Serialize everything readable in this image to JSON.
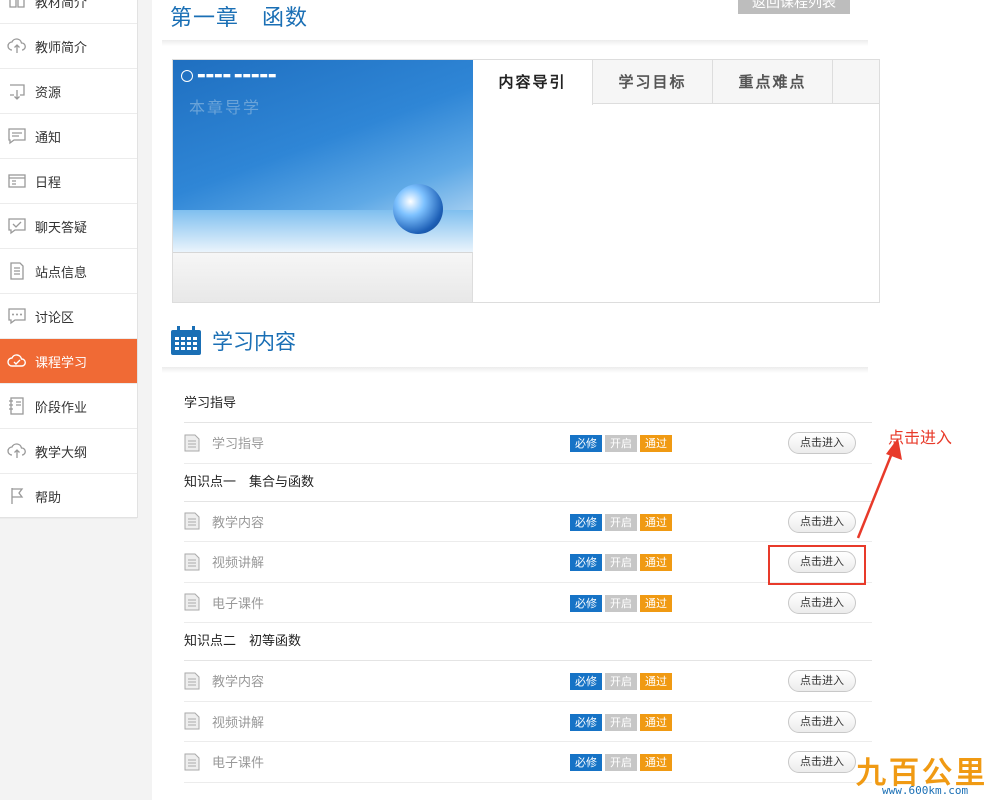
{
  "sidebar": {
    "items": [
      {
        "label": "教材简介",
        "icon": "book-icon"
      },
      {
        "label": "教师简介",
        "icon": "cloud-upload-icon"
      },
      {
        "label": "资源",
        "icon": "download-box-icon"
      },
      {
        "label": "通知",
        "icon": "message-icon"
      },
      {
        "label": "日程",
        "icon": "calendar-card-icon"
      },
      {
        "label": "聊天答疑",
        "icon": "chat-check-icon"
      },
      {
        "label": "站点信息",
        "icon": "document-icon"
      },
      {
        "label": "讨论区",
        "icon": "speech-dots-icon"
      },
      {
        "label": "课程学习",
        "icon": "cloud-check-icon",
        "active": true
      },
      {
        "label": "阶段作业",
        "icon": "notebook-icon"
      },
      {
        "label": "教学大纲",
        "icon": "cloud-upload-icon"
      },
      {
        "label": "帮助",
        "icon": "flag-icon"
      }
    ]
  },
  "header": {
    "chapter_title": "第一章　函数",
    "back_label": "返回课程列表"
  },
  "intro": {
    "banner_title": "本章导学",
    "tabs": [
      "内容导引",
      "学习目标",
      "重点难点"
    ]
  },
  "section": {
    "title": "学习内容"
  },
  "badges": {
    "required": "必修",
    "open": "开启",
    "pass": "通过"
  },
  "enter_label": "点击进入",
  "groups": [
    {
      "title": "学习指导",
      "items": [
        "学习指导"
      ]
    },
    {
      "title": "知识点一　集合与函数",
      "items": [
        "教学内容",
        "视频讲解",
        "电子课件"
      ]
    },
    {
      "title": "知识点二　初等函数",
      "items": [
        "教学内容",
        "视频讲解",
        "电子课件"
      ]
    }
  ],
  "annotation": {
    "text": "点击进入",
    "color": "#e83a2a"
  },
  "watermark": {
    "main": "九百公里",
    "url": "www.600km.com"
  },
  "colors": {
    "accent_orange": "#f06a35",
    "title_blue": "#1a6fb5",
    "badge_blue": "#1673c6",
    "badge_gray": "#c7c7c7",
    "badge_orange": "#f09a13"
  }
}
